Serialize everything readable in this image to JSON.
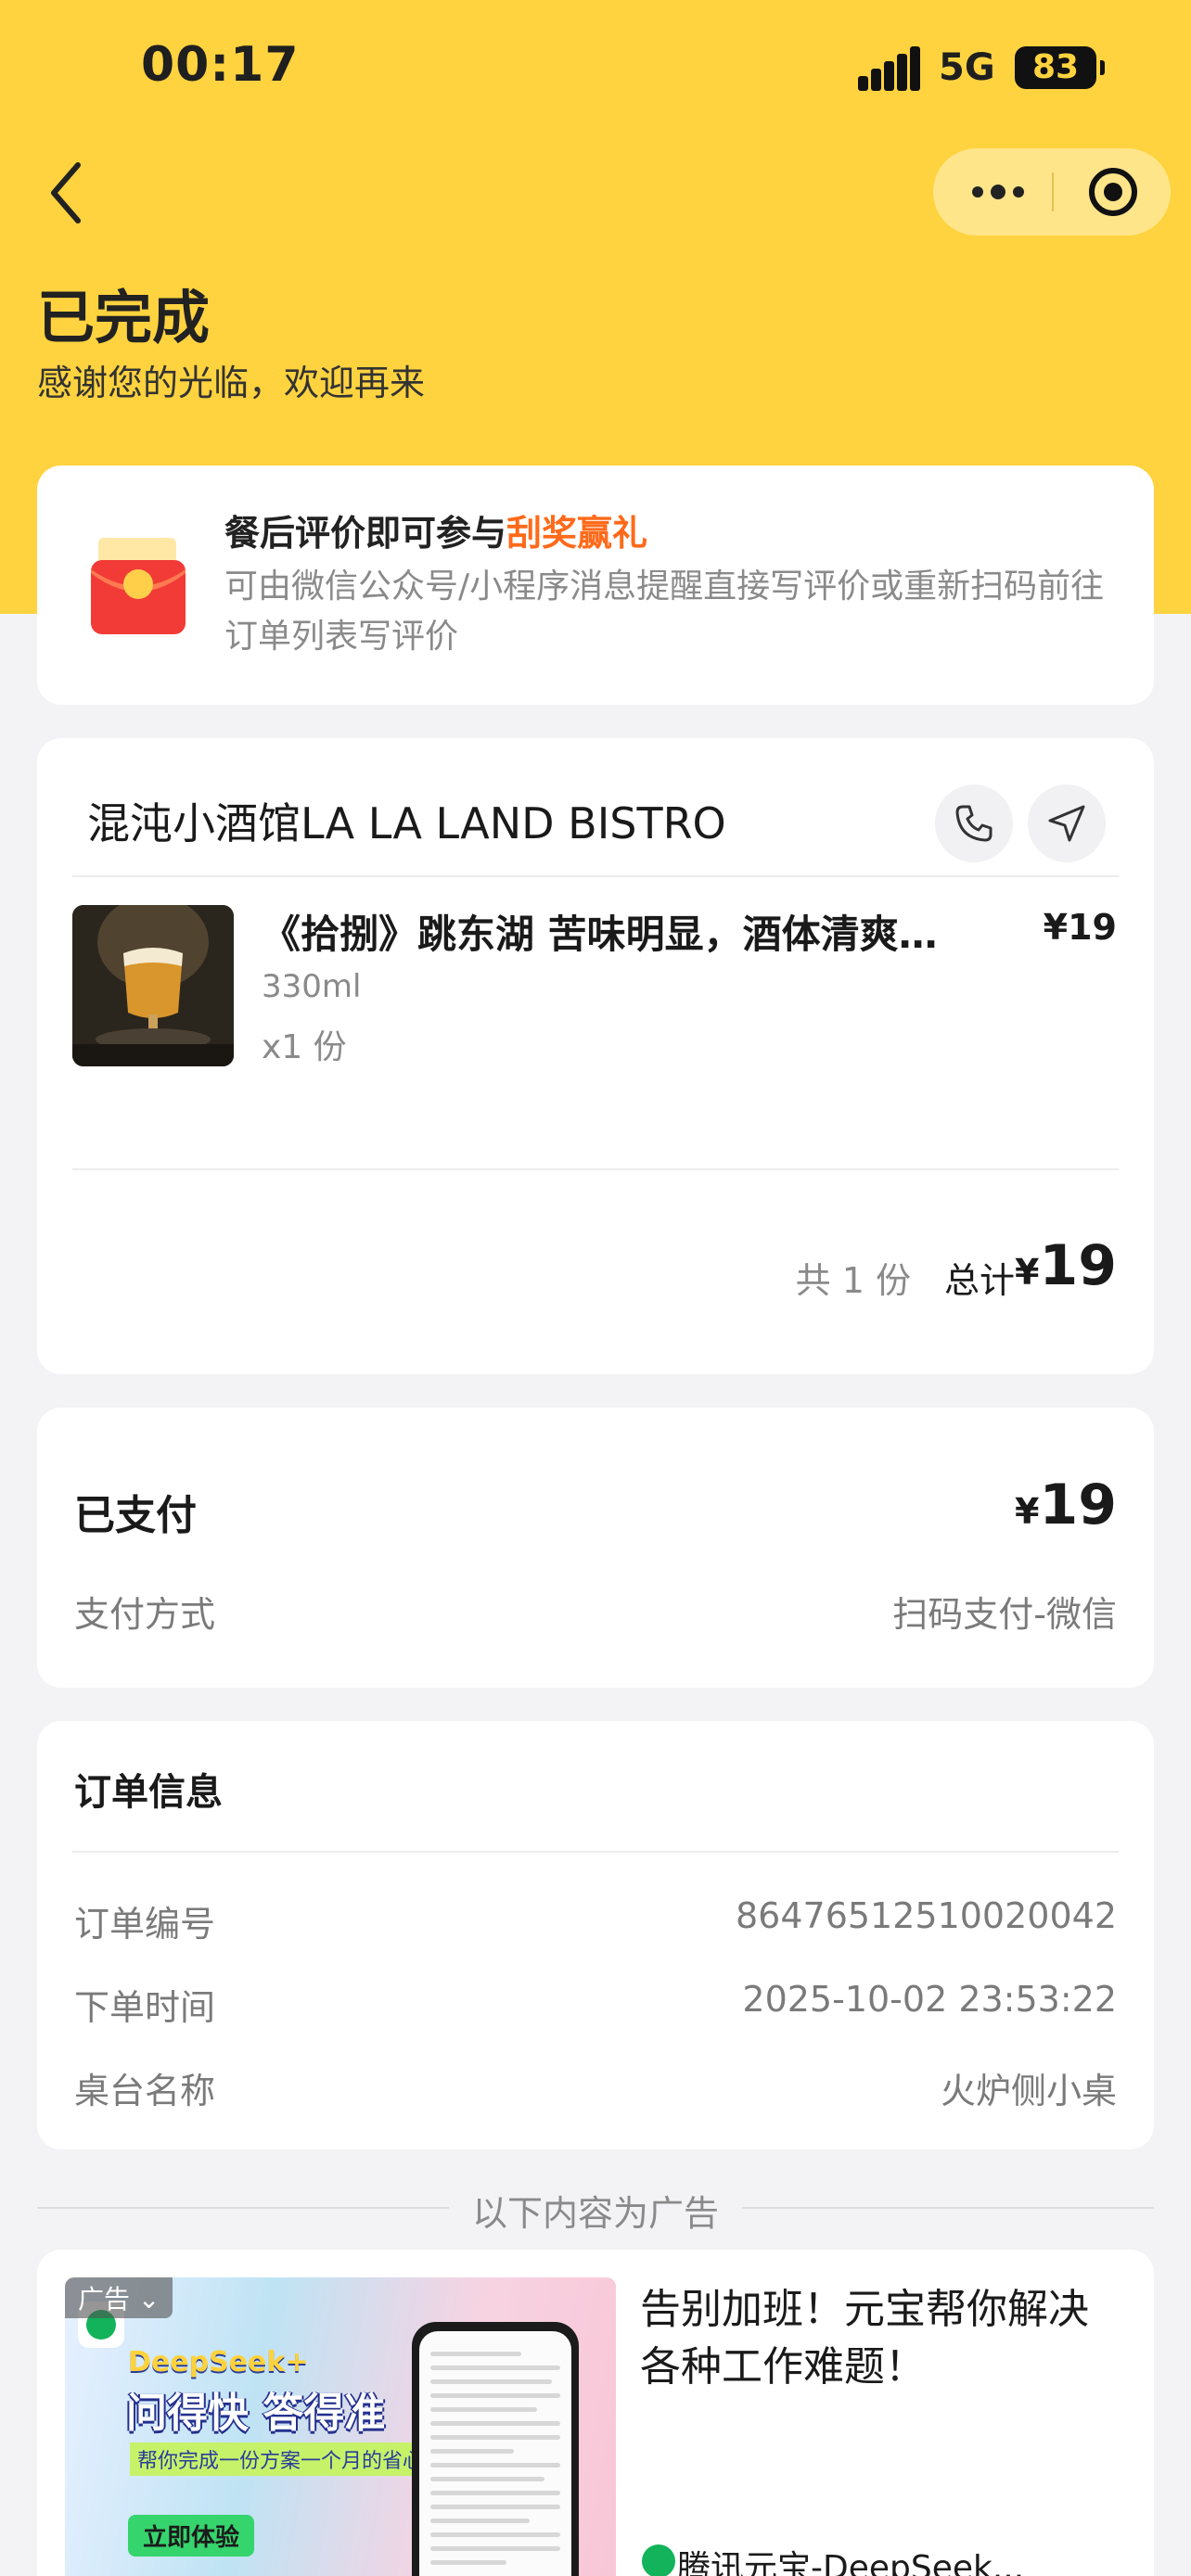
{
  "status_bar": {
    "time": "00:17",
    "network": "5G",
    "battery": "83"
  },
  "header": {
    "title": "已完成",
    "subtitle": "感谢您的光临，欢迎再来"
  },
  "promo": {
    "headline_prefix": "餐后评价即可参与",
    "headline_highlight": "刮奖赢礼",
    "body": "可由微信公众号/小程序消息提醒直接写评价或重新扫码前往订单列表写评价",
    "icon_text": "券",
    "accent_color": "#ff6a1a"
  },
  "order": {
    "store_name": "混沌小酒馆LA LA LAND BISTRO",
    "item": {
      "name": "《拾捌》跳东湖 苦味明显，酒体清爽…",
      "price": "¥19",
      "spec": "330ml",
      "qty": "x1 份"
    },
    "count_text": "共 1 份",
    "total_label": "总计",
    "currency": "¥",
    "total_amount": "19"
  },
  "payment": {
    "status_label": "已支付",
    "currency": "¥",
    "amount": "19",
    "method_label": "支付方式",
    "method_value": "扫码支付-微信"
  },
  "order_info": {
    "title": "订单信息",
    "rows": [
      {
        "label": "订单编号",
        "value": "86476512510020042"
      },
      {
        "label": "下单时间",
        "value": "2025-10-02 23:53:22"
      },
      {
        "label": "桌台名称",
        "value": "火炉侧小桌"
      }
    ]
  },
  "ad": {
    "divider": "以下内容为广告",
    "badge": "广告",
    "image_brand": "DeepSeek+",
    "image_slogan": "问得快 答得准",
    "image_small": "帮你完成一份方案一个月的省心工作计划",
    "image_cta": "立即体验",
    "headline": "告别加班！元宝帮你解决各种工作难题！",
    "source": "腾讯元宝-DeepSeek..."
  },
  "colors": {
    "header_bg": "#ffd33f",
    "page_bg": "#f3f3f5"
  }
}
